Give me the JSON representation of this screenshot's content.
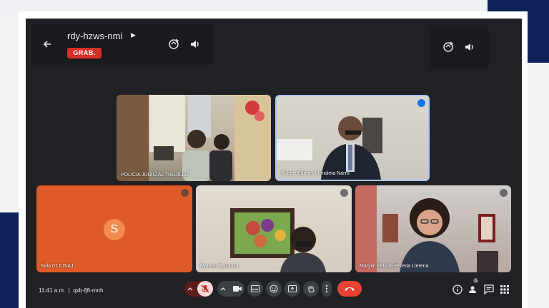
{
  "meeting": {
    "code": "rdy-hzws-nmi",
    "recording_badge": "GRAB.",
    "footer_time": "11:41 a.m.",
    "footer_code": "qxb-fjft-mnh",
    "footer_separator": "|"
  },
  "participants": [
    {
      "name": "POLICIA JUDICIAL TRUJILLO"
    },
    {
      "name": "Robert Banner Mendieta Narro"
    },
    {
      "name": "Sala 01 CISAJ",
      "avatar_letter": "S"
    },
    {
      "name": "Manuel Carranza"
    },
    {
      "name": "Marylin Felicita Pereda Llerena"
    }
  ],
  "people_count": "5",
  "icons": {
    "back": "arrow-left-icon",
    "camera_switch": "camera-switch-icon",
    "volume": "speaker-icon",
    "mic_off": "mic-off-icon",
    "camera": "camera-icon",
    "captions": "captions-icon",
    "emoji": "emoji-icon",
    "present": "present-icon",
    "hand": "raise-hand-icon",
    "more": "more-vert-icon",
    "hangup": "hang-up-icon",
    "info": "info-icon",
    "people": "people-icon",
    "chat": "chat-icon",
    "activities": "activities-icon"
  },
  "colors": {
    "background": "#202124",
    "recording": "#d93025",
    "hangup": "#ea4335",
    "avatar_tile": "#de5a26",
    "brand_navy": "#0d2357"
  }
}
